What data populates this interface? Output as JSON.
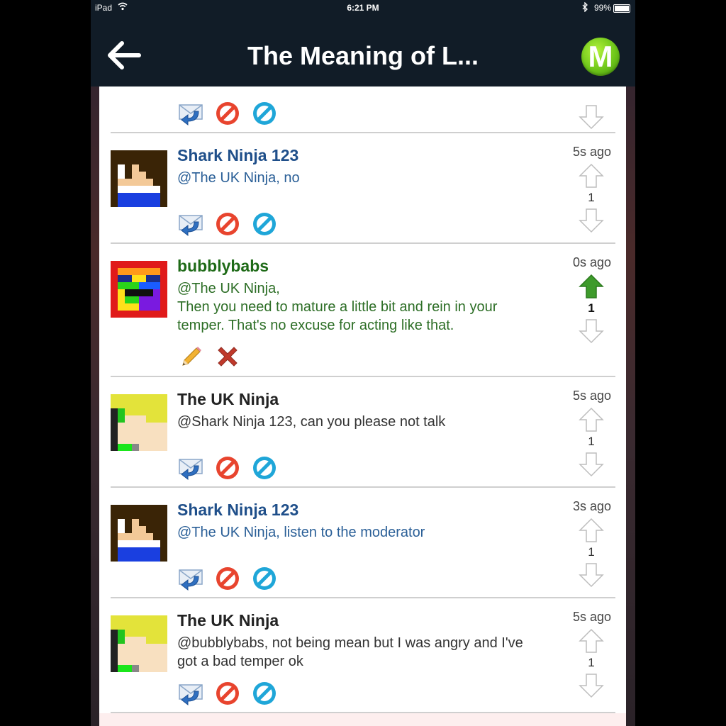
{
  "status_bar": {
    "device": "iPad",
    "time": "6:21 PM",
    "battery": "99%"
  },
  "nav": {
    "title": "The Meaning of L...",
    "logo_letter": "M"
  },
  "colors": {
    "nav_bg": "#111c27",
    "username_blue": "#1f4f8a",
    "username_green": "#1e6a17",
    "upvote_active": "#3e9b2b",
    "logo_green": "#6ec61a"
  },
  "posts": [
    {
      "username": "",
      "message": "",
      "time": "",
      "score": "",
      "avatar": "uk-ninja-avatar",
      "actions": [
        "reply-icon",
        "block-icon",
        "ignore-icon"
      ]
    },
    {
      "username": "Shark Ninja 123",
      "message": "@The UK Ninja, no",
      "time": "5s ago",
      "score": "1",
      "avatar": "shark-ninja-avatar",
      "actions": [
        "reply-icon",
        "block-icon",
        "ignore-icon"
      ]
    },
    {
      "username": "bubblybabs",
      "message": "@The UK Ninja,\nThen you need to mature a little bit and rein in your temper. That's no excuse for acting like that.",
      "message_line1": "@The UK Ninja,",
      "message_line2": "Then you need to mature a little bit and rein in your temper. That's no excuse for acting like that.",
      "time": "0s ago",
      "score": "1",
      "upvoted": true,
      "avatar": "rainbow-avatar",
      "actions": [
        "edit-icon",
        "delete-icon"
      ]
    },
    {
      "username": "The UK Ninja",
      "message": "@Shark Ninja 123, can you please not talk",
      "time": "5s ago",
      "score": "1",
      "avatar": "uk-ninja-avatar",
      "actions": [
        "reply-icon",
        "block-icon",
        "ignore-icon"
      ]
    },
    {
      "username": "Shark Ninja 123",
      "message": "@The UK Ninja, listen to the moderator",
      "time": "3s ago",
      "score": "1",
      "avatar": "shark-ninja-avatar",
      "actions": [
        "reply-icon",
        "block-icon",
        "ignore-icon"
      ]
    },
    {
      "username": "The UK Ninja",
      "message": "@bubblybabs, not being mean but I was angry and I've got a bad temper ok",
      "time": "5s ago",
      "score": "1",
      "avatar": "uk-ninja-avatar",
      "actions": [
        "reply-icon",
        "block-icon",
        "ignore-icon"
      ]
    }
  ]
}
